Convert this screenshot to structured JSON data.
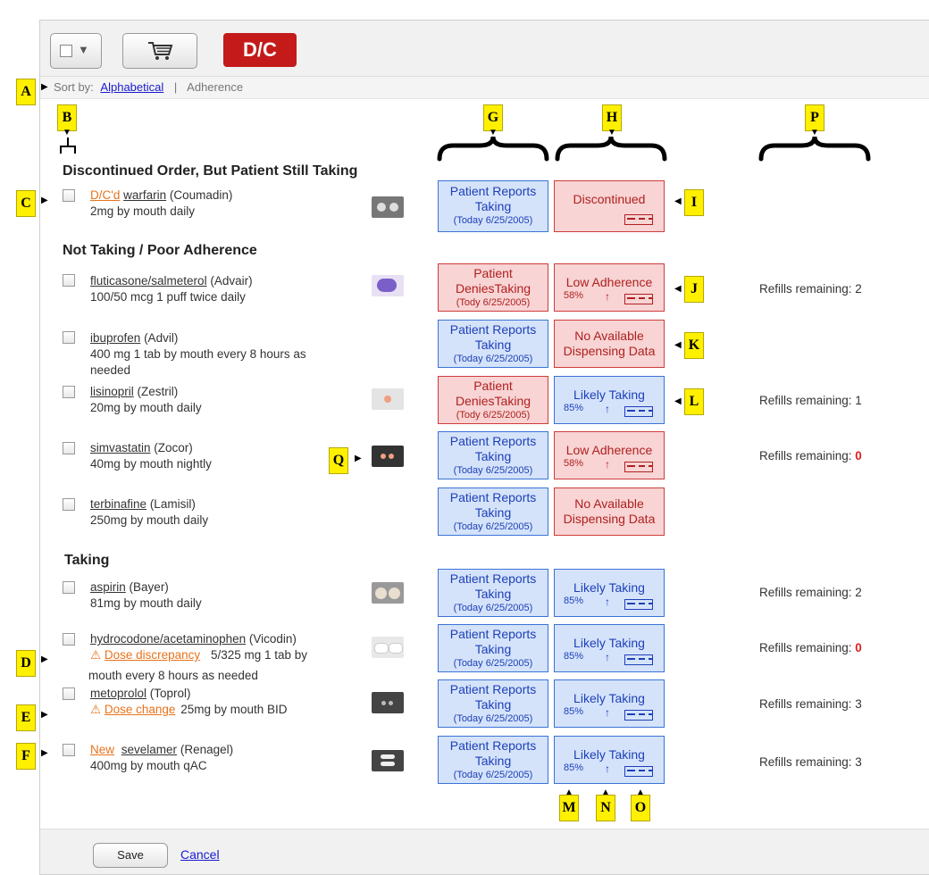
{
  "toolbar": {
    "dc_label": "D/C"
  },
  "sort": {
    "prefix": "Sort by:",
    "alphabetical": "Alphabetical",
    "separator": "|",
    "adherence": "Adherence"
  },
  "callouts": {
    "A": "A",
    "B": "B",
    "C": "C",
    "D": "D",
    "E": "E",
    "F": "F",
    "G": "G",
    "H": "H",
    "I": "I",
    "J": "J",
    "K": "K",
    "L": "L",
    "M": "M",
    "N": "N",
    "O": "O",
    "P": "P",
    "Q": "Q"
  },
  "sections": {
    "discontinued": "Discontinued Order, But Patient Still Taking",
    "not_taking": "Not Taking / Poor Adherence",
    "taking": "Taking"
  },
  "meds": {
    "warfarin": {
      "tag": "D/C'd",
      "name": "warfarin",
      "brand": "(Coumadin)",
      "dose": "2mg by mouth  daily"
    },
    "advair": {
      "name": "fluticasone/salmeterol",
      "brand": "(Advair)",
      "dose": "100/50 mcg 1 puff twice daily"
    },
    "ibuprofen": {
      "name": "ibuprofen",
      "brand": "(Advil)",
      "dose1": "400 mg 1 tab by mouth every 8 hours as",
      "dose2": "needed"
    },
    "lisinopril": {
      "name": "lisinopril",
      "brand": "(Zestril)",
      "dose": "20mg by mouth daily"
    },
    "simvastatin": {
      "name": "simvastatin",
      "brand": "(Zocor)",
      "dose": "40mg by mouth  nightly"
    },
    "terbinafine": {
      "name": "terbinafine",
      "brand": "(Lamisil)",
      "dose": "250mg by mouth  daily"
    },
    "aspirin": {
      "name": "aspirin",
      "brand": "(Bayer)",
      "dose": "81mg by mouth  daily"
    },
    "vicodin": {
      "name": "hydrocodone/acetaminophen",
      "brand": "(Vicodin)",
      "warn": "Dose discrepancy",
      "dose1": "5/325 mg 1 tab by",
      "dose2": "mouth every 8 hours as needed"
    },
    "toprol": {
      "name": "metoprolol",
      "brand": "(Toprol)",
      "warn": "Dose change",
      "dose": "25mg by mouth  BID"
    },
    "renagel": {
      "tag": "New",
      "name": "sevelamer",
      "brand": "(Renagel)",
      "dose": "400mg by mouth  qAC"
    }
  },
  "reports": {
    "reports_l1": "Patient Reports",
    "reports_l2": "Taking",
    "denies_l1": "Patient",
    "denies_l2": "DeniesTaking",
    "date_today": "(Today 6/25/2005)",
    "date_tody": "(Tody 6/25/2005)"
  },
  "adherence": {
    "discontinued": "Discontinued",
    "low": "Low Adherence",
    "low_pct": "58%",
    "likely": "Likely Taking",
    "likely_pct": "85%",
    "nodata_l1": "No Available",
    "nodata_l2": "Dispensing Data",
    "up_glyph": "↑"
  },
  "refills": {
    "prefix": "Refills remaining: ",
    "advair": "2",
    "lisinopril": "1",
    "simvastatin": "0",
    "aspirin": "2",
    "vicodin": "0",
    "toprol": "3",
    "renagel": "3"
  },
  "footer": {
    "save": "Save",
    "cancel": "Cancel"
  }
}
